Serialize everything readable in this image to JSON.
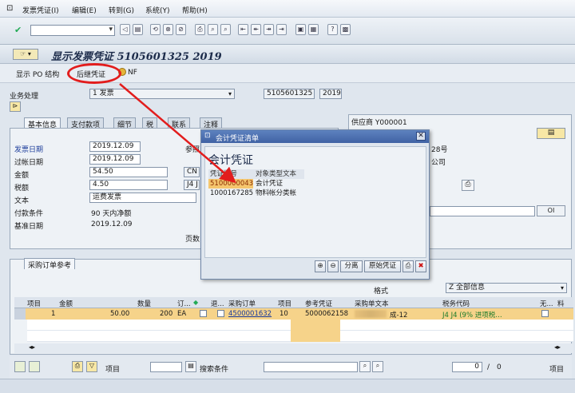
{
  "menu": [
    "发票凭证(I)",
    "编辑(E)",
    "转到(G)",
    "系统(Y)",
    "帮助(H)"
  ],
  "title": "显示发票凭证 5105601325 2019",
  "toolbar2": {
    "po_structure": "显示 PO 结构",
    "follow_doc": "后继凭证",
    "nf": "NF"
  },
  "transaction": {
    "label": "业务处理",
    "value": "1 发票",
    "doc_no": "5105601325",
    "year": "2019"
  },
  "tabs": [
    "基本信息",
    "支付款项",
    "细节",
    "税",
    "联系",
    "注释"
  ],
  "basic": {
    "invoice_date_label": "发票日期",
    "invoice_date": "2019.12.09",
    "posting_date_label": "过帐日期",
    "posting_date": "2019.12.09",
    "amount_label": "金额",
    "amount": "54.50",
    "tax_label": "税额",
    "tax": "4.50",
    "text_label": "文本",
    "text": "运费发票",
    "payterm_label": "付款条件",
    "payterm": "90 天内净额",
    "baseline_label": "基准日期",
    "baseline": "2019.12.09",
    "ref_label": "参照",
    "cur_abbr": "CN",
    "j4_abbr": "J4 J",
    "page_label": "页数"
  },
  "vendor": {
    "label": "供应商 Y000001",
    "frag1": "28号",
    "frag2": "公司",
    "oi": "OI"
  },
  "popup": {
    "title": "会计凭证清单",
    "heading": "会计凭证",
    "col1": "凭证编号",
    "col2": "对象类型文本",
    "rows": [
      {
        "no": "5100000043",
        "type": "会计凭证"
      },
      {
        "no": "1000167285",
        "type": "物料帐分类帐"
      }
    ],
    "btn_split": "分离",
    "btn_orig": "原始凭证"
  },
  "po_tab": "采购订单参考",
  "layout_label": "格式",
  "layout_value": "Z 全部信息",
  "grid": {
    "headers": [
      "项目",
      "金额",
      "数量",
      "订...",
      "退...",
      "采购订单",
      "项目",
      "参考凭证",
      "采购单文本",
      "税务代码",
      "无...",
      "料"
    ],
    "row": {
      "item": "1",
      "amount": "50.00",
      "qty": "200",
      "unit": "EA",
      "po": "4500001632",
      "po_item": "10",
      "ref": "5000062158",
      "text_tail": "成-12",
      "tax": "J4 J4 (9% 进项税…"
    }
  },
  "bottom": {
    "item_label": "项目",
    "search_label": "搜索条件",
    "count": "0",
    "sep": "/",
    "total": "0",
    "item_label2": "项目"
  }
}
